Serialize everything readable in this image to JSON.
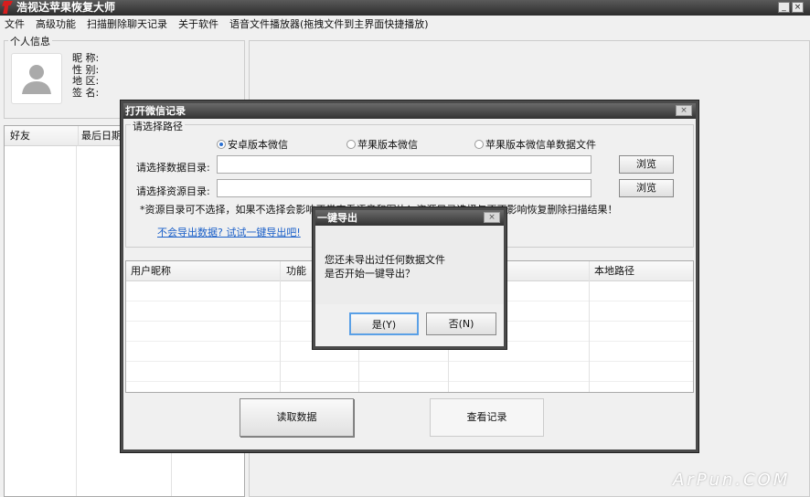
{
  "app": {
    "title": "浩视达苹果恢复大师"
  },
  "menu": [
    "文件",
    "高级功能",
    "扫描删除聊天记录",
    "关于软件",
    "语音文件播放器(拖拽文件到主界面快捷播放)"
  ],
  "profile": {
    "group_label": "个人信息",
    "fields": [
      "昵 称:",
      "性 别:",
      "地 区:",
      "签 名:"
    ]
  },
  "friends": {
    "columns": [
      "好友",
      "最后日期"
    ]
  },
  "open_dialog": {
    "title": "打开微信记录",
    "group_label": "请选择路径",
    "radios": [
      {
        "label": "安卓版本微信",
        "checked": true
      },
      {
        "label": "苹果版本微信",
        "checked": false
      },
      {
        "label": "苹果版本微信单数据文件",
        "checked": false
      }
    ],
    "data_dir_label": "请选择数据目录:",
    "data_dir_value": "",
    "res_dir_label": "请选择资源目录:",
    "res_dir_value": "",
    "browse": "浏览",
    "hint": "*资源目录可不选择，如果不选择会影响正常查看语音和图片！资源目录选择与否不影响恢复删除扫描结果！",
    "link": "不会导出数据? 试试一键导出吧!",
    "columns": [
      "用户昵称",
      "功能",
      "",
      "",
      "本地路径"
    ],
    "read_button": "读取数据",
    "view_button": "查看记录"
  },
  "confirm_dialog": {
    "title": "一键导出",
    "line1": "您还未导出过任何数据文件",
    "line2": "是否开始一键导出？",
    "yes": "是(Y)",
    "no": "否(N)"
  },
  "watermark": "ArPun.COM"
}
